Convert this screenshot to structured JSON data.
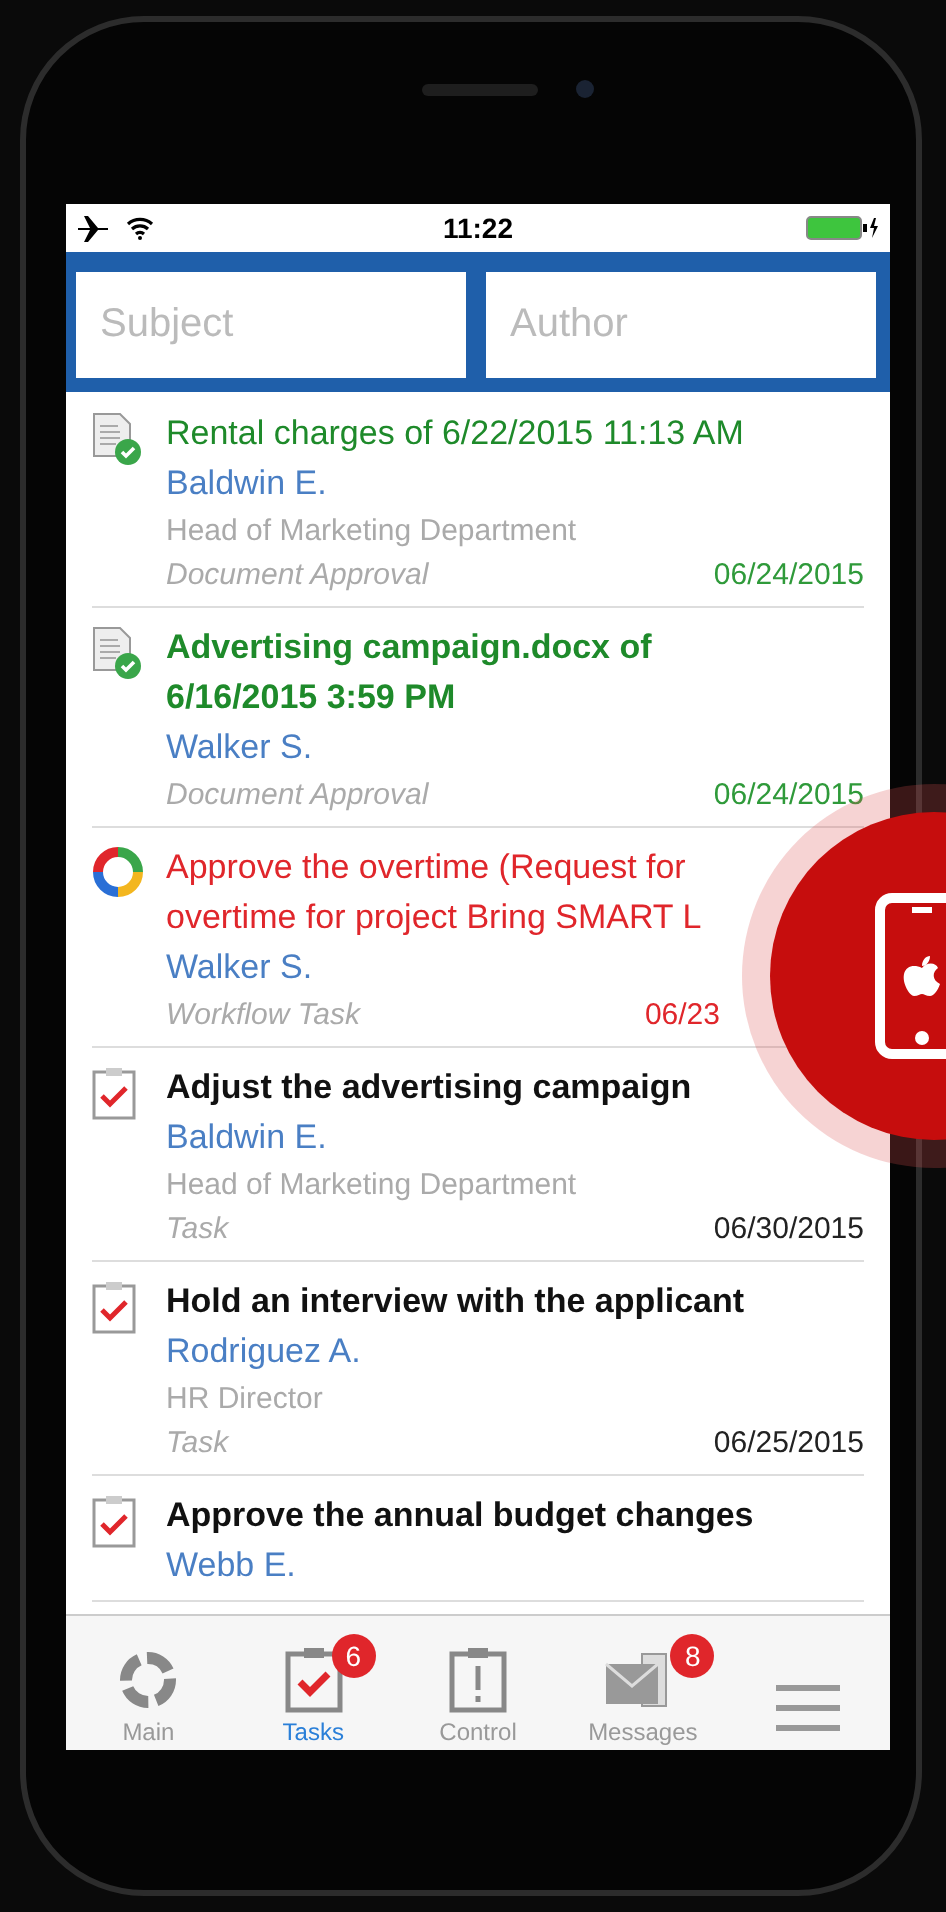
{
  "status_bar": {
    "time": "11:22"
  },
  "search": [
    {
      "placeholder": "Subject"
    },
    {
      "placeholder": "Author"
    }
  ],
  "items": [
    {
      "kind": "document",
      "unread": false,
      "title": "Rental charges of 6/22/2015 11:13 AM",
      "author": "Baldwin E.",
      "position": "Head of Marketing Department",
      "type": "Document Approval",
      "date": "06/24/2015"
    },
    {
      "kind": "document",
      "unread": true,
      "title": "Advertising campaign.docx of 6/16/2015 3:59 PM",
      "author": "Walker S.",
      "type": "Document Approval",
      "date": "06/24/2015"
    },
    {
      "kind": "workflow",
      "unread": false,
      "title": "Approve the overtime (Request for overtime for project Bring SMART L",
      "author": "Walker S.",
      "type": "Workflow Task",
      "date": "06/23"
    },
    {
      "kind": "task",
      "unread": true,
      "title": "Adjust the advertising campaign",
      "author": "Baldwin E.",
      "position": "Head of Marketing Department",
      "type": "Task",
      "date": "06/30/2015"
    },
    {
      "kind": "task",
      "unread": true,
      "title": "Hold an interview with the applicant",
      "author": "Rodriguez A.",
      "position": "HR Director",
      "type": "Task",
      "date": "06/25/2015"
    },
    {
      "kind": "task",
      "unread": true,
      "title": "Approve the annual budget changes",
      "author": "Webb E."
    }
  ],
  "tab_bar": [
    {
      "kind": "main",
      "label": "Main",
      "selected": false
    },
    {
      "kind": "tasks",
      "label": "Tasks",
      "selected": true,
      "badge": "6"
    },
    {
      "kind": "control",
      "label": "Control",
      "selected": false
    },
    {
      "kind": "messages",
      "label": "Messages",
      "selected": false,
      "badge": "8"
    },
    {
      "kind": "menu",
      "selected": false
    }
  ]
}
